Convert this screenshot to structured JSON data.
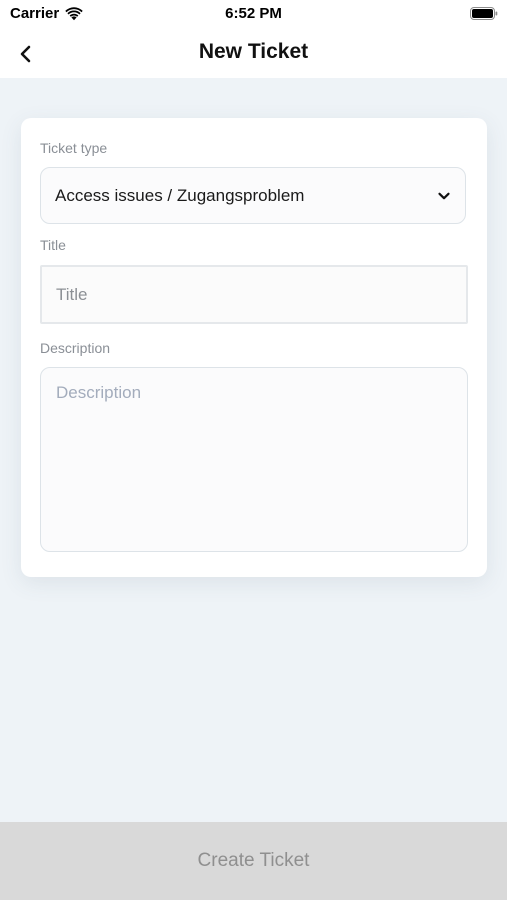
{
  "status_bar": {
    "carrier": "Carrier",
    "time": "6:52 PM",
    "wifi_icon": "wifi-icon",
    "battery_icon": "battery-icon"
  },
  "nav": {
    "title": "New Ticket",
    "back_icon": "chevron-left-icon"
  },
  "form": {
    "ticket_type_label": "Ticket type",
    "ticket_type_value": "Access issues / Zugangsproblem",
    "ticket_type_icon": "chevron-down-icon",
    "title_label": "Title",
    "title_placeholder": "Title",
    "description_label": "Description",
    "description_placeholder": "Description"
  },
  "footer": {
    "create_label": "Create Ticket"
  },
  "colors": {
    "page_background": "#eef3f7",
    "card_background": "#ffffff",
    "button_background": "#d9d9d9",
    "button_text": "#8f8f8f",
    "label_text": "#8a8f96"
  }
}
